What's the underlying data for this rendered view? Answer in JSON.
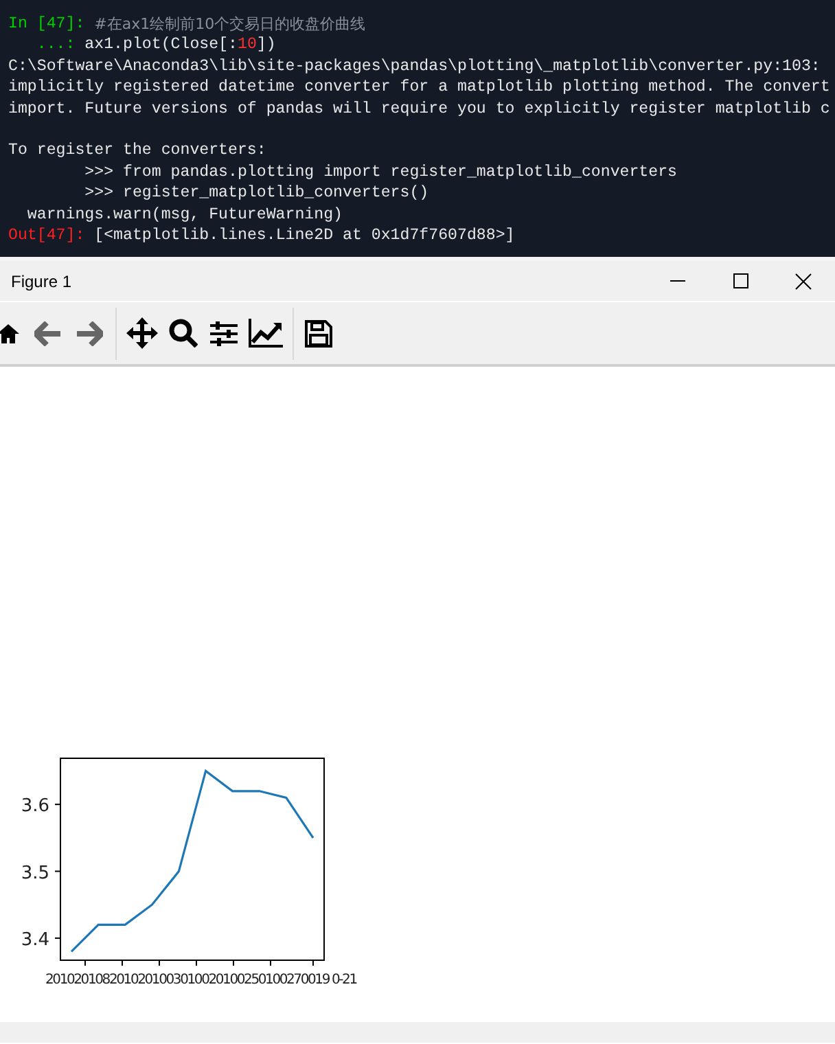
{
  "console": {
    "lines": [
      {
        "kind": "text",
        "segments": [
          {
            "kind": "prompt",
            "text": "In [47]: "
          },
          {
            "kind": "comment",
            "text": "#在ax1绘制前10个交易日的收盘价曲线"
          }
        ]
      },
      {
        "kind": "text",
        "segments": [
          {
            "kind": "prompt",
            "text": "   ...: "
          },
          {
            "kind": "code",
            "text": "ax1.plot(Close[:"
          },
          {
            "kind": "number",
            "text": "10"
          },
          {
            "kind": "code",
            "text": "])"
          }
        ]
      },
      {
        "kind": "text",
        "segments": [
          {
            "kind": "output",
            "text": "C:\\Software\\Anaconda3\\lib\\site-packages\\pandas\\plotting\\_matplotlib\\converter.py:103:"
          }
        ]
      },
      {
        "kind": "text",
        "segments": [
          {
            "kind": "output",
            "text": "implicitly registered datetime converter for a matplotlib plotting method. The convert"
          }
        ]
      },
      {
        "kind": "text",
        "segments": [
          {
            "kind": "output",
            "text": "import. Future versions of pandas will require you to explicitly register matplotlib c"
          }
        ]
      },
      {
        "kind": "blank"
      },
      {
        "kind": "text",
        "segments": [
          {
            "kind": "output",
            "text": "To register the converters:"
          }
        ]
      },
      {
        "kind": "text",
        "segments": [
          {
            "kind": "output",
            "text": "        >>> from pandas.plotting import register_matplotlib_converters"
          }
        ]
      },
      {
        "kind": "text",
        "segments": [
          {
            "kind": "output",
            "text": "        >>> register_matplotlib_converters()"
          }
        ]
      },
      {
        "kind": "text",
        "segments": [
          {
            "kind": "output",
            "text": "  warnings.warn(msg, FutureWarning)"
          }
        ]
      },
      {
        "kind": "text",
        "segments": [
          {
            "kind": "out_prompt",
            "text": "Out[47]: "
          },
          {
            "kind": "output",
            "text": "[<matplotlib.lines.Line2D at 0x1d7f7607d88>]"
          }
        ]
      }
    ]
  },
  "window": {
    "title": "Figure 1"
  },
  "plot": {
    "x_tick_text": "2010201082010201003010020100250100270019 0-21",
    "chart_data": {
      "type": "line",
      "categories": [
        null,
        null,
        null,
        null,
        null,
        null,
        null,
        null,
        null,
        null
      ],
      "series": [
        {
          "color": "#1f77b4",
          "values": [
            3.38,
            3.42,
            3.42,
            3.45,
            3.5,
            3.65,
            3.62,
            3.62,
            3.61,
            3.55
          ]
        }
      ],
      "ylim": [
        3.367,
        3.669
      ],
      "yticks": [
        {
          "value": 3.4,
          "label": "3.4"
        },
        {
          "value": 3.5,
          "label": "3.5"
        },
        {
          "value": 3.6,
          "label": "3.6"
        }
      ]
    }
  }
}
